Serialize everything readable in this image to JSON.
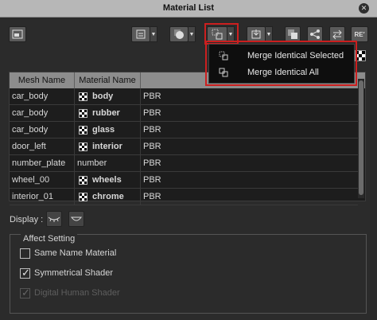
{
  "window": {
    "title": "Material List",
    "close_icon": "close-icon"
  },
  "toolbar": {
    "layout_button_icon": "panel-layout-icon",
    "buttons": [
      {
        "name": "list-options",
        "icon": "list-options-icon"
      },
      {
        "name": "sphere-material",
        "icon": "sphere-icon"
      },
      {
        "name": "merge-identical",
        "icon": "merge-icon"
      },
      {
        "name": "export-material",
        "icon": "export-icon"
      },
      {
        "name": "copy-material",
        "icon": "copy-icon"
      },
      {
        "name": "share-material",
        "icon": "share-icon"
      },
      {
        "name": "swap-material",
        "icon": "swap-icon"
      },
      {
        "name": "rename-material",
        "icon": "rename-icon",
        "label": "RE′"
      }
    ]
  },
  "dropdown_menu": {
    "items": [
      {
        "label": "Merge Identical Selected",
        "icon": "merge-selected-icon"
      },
      {
        "label": "Merge Identical All",
        "icon": "merge-all-icon"
      }
    ]
  },
  "table": {
    "columns": [
      "Mesh Name",
      "Material Name"
    ],
    "rows": [
      {
        "mesh": "car_body",
        "material": "body",
        "shader": "PBR",
        "has_swatch": true
      },
      {
        "mesh": "car_body",
        "material": "rubber",
        "shader": "PBR",
        "has_swatch": true
      },
      {
        "mesh": "car_body",
        "material": "glass",
        "shader": "PBR",
        "has_swatch": true
      },
      {
        "mesh": "door_left",
        "material": "interior",
        "shader": "PBR",
        "has_swatch": true
      },
      {
        "mesh": "number_plate",
        "material": "number",
        "shader": "PBR",
        "has_swatch": false
      },
      {
        "mesh": "wheel_00",
        "material": "wheels",
        "shader": "PBR",
        "has_swatch": true
      },
      {
        "mesh": "interior_01",
        "material": "chrome",
        "shader": "PBR",
        "has_swatch": true
      }
    ]
  },
  "display": {
    "label": "Display :",
    "buttons": [
      "display-lashes-icon",
      "display-mouth-icon"
    ]
  },
  "affect_setting": {
    "legend": "Affect Setting",
    "options": [
      {
        "label": "Same Name Material",
        "checked": false,
        "enabled": true
      },
      {
        "label": "Symmetrical Shader",
        "checked": true,
        "enabled": true
      },
      {
        "label": "Digital Human Shader",
        "checked": true,
        "enabled": false
      }
    ]
  },
  "colors": {
    "highlight": "#cc1f1f",
    "background": "#2b2b2b",
    "titlebar": "#b7b7b7"
  }
}
